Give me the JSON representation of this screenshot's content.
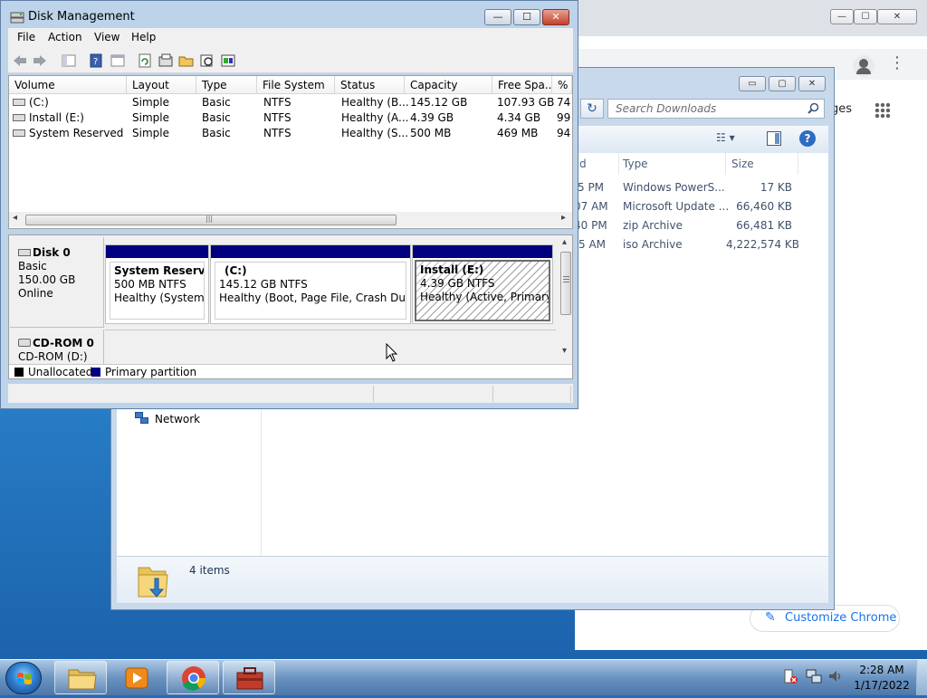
{
  "chrome": {
    "images_label": "ges",
    "customize_label": "Customize Chrome",
    "window_buttons": {
      "minimize": "—",
      "maximize": "☐",
      "close": "✕"
    },
    "menu_glyph": "⋮"
  },
  "explorer": {
    "search_placeholder": "Search Downloads",
    "refresh_glyph": "↻",
    "window_buttons": {
      "minimize": "▭",
      "maximize": "▢",
      "close": "✕"
    },
    "view_glyph": "☷ ▾",
    "help_glyph": "?",
    "columns": {
      "date_fragment": "d",
      "type": "Type",
      "size": "Size"
    },
    "rows": [
      {
        "date": "5 PM",
        "type": "Windows PowerS...",
        "size": "17 KB"
      },
      {
        "date": "07 AM",
        "type": "Microsoft Update ...",
        "size": "66,460 KB"
      },
      {
        "date": "40 PM",
        "type": "zip Archive",
        "size": "66,481 KB"
      },
      {
        "date": "5 AM",
        "type": "iso Archive",
        "size": "4,222,574 KB"
      }
    ],
    "nav_network": "Network",
    "details_count": "4 items"
  },
  "disk_management": {
    "title": "Disk Management",
    "window_buttons": {
      "minimize": "—",
      "maximize": "☐",
      "close": "✕"
    },
    "menu": [
      "File",
      "Action",
      "View",
      "Help"
    ],
    "list_headers": [
      "Volume",
      "Layout",
      "Type",
      "File System",
      "Status",
      "Capacity",
      "Free Spa...",
      "% F"
    ],
    "volumes": [
      {
        "volume": "(C:)",
        "layout": "Simple",
        "type": "Basic",
        "fs": "NTFS",
        "status": "Healthy (B...",
        "capacity": "145.12 GB",
        "free": "107.93 GB",
        "pct": "74"
      },
      {
        "volume": "Install (E:)",
        "layout": "Simple",
        "type": "Basic",
        "fs": "NTFS",
        "status": "Healthy (A...",
        "capacity": "4.39 GB",
        "free": "4.34 GB",
        "pct": "99"
      },
      {
        "volume": "System Reserved",
        "layout": "Simple",
        "type": "Basic",
        "fs": "NTFS",
        "status": "Healthy (S...",
        "capacity": "500 MB",
        "free": "469 MB",
        "pct": "94"
      }
    ],
    "scroll_glyphs": {
      "left": "◂",
      "right": "▸",
      "up": "▴",
      "down": "▾",
      "grip": "|||"
    },
    "disk0": {
      "name": "Disk 0",
      "type": "Basic",
      "size": "150.00 GB",
      "state": "Online"
    },
    "partitions": [
      {
        "name": "System Reserved",
        "size": "500 MB NTFS",
        "status": "Healthy (System, P"
      },
      {
        "name": "(C:)",
        "size": "145.12 GB NTFS",
        "status": "Healthy (Boot, Page File, Crash Dump, P"
      },
      {
        "name": "Install  (E:)",
        "size": "4.39 GB NTFS",
        "status": "Healthy (Active, Primary Pa"
      }
    ],
    "cdrom": {
      "name": "CD-ROM 0",
      "drive": "CD-ROM (D:)"
    },
    "legend": [
      {
        "label": "Unallocated",
        "color": "#000000"
      },
      {
        "label": "Primary partition",
        "color": "#000080"
      }
    ]
  },
  "taskbar": {
    "time": "2:28 AM",
    "date": "1/17/2022"
  }
}
